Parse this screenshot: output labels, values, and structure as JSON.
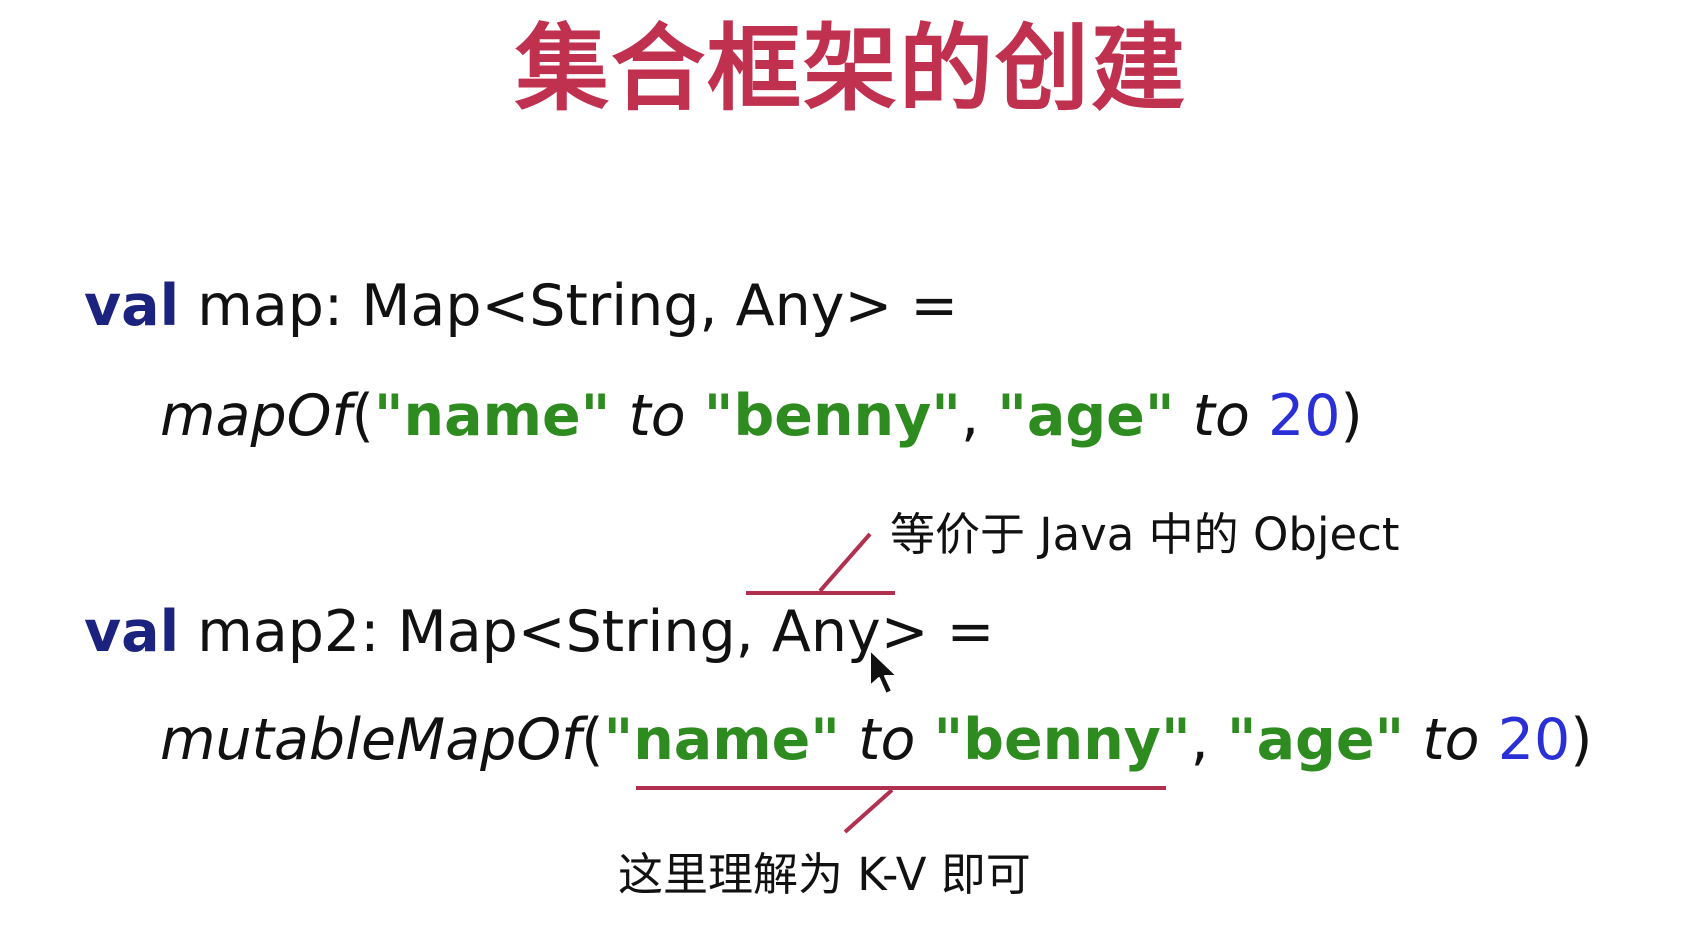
{
  "title": "集合框架的创建",
  "colors": {
    "title": "#c0304f",
    "keyword": "#1c237e",
    "string": "#2e8b1f",
    "number": "#2a2fd6",
    "annotation_line": "#b03050",
    "text": "#111111"
  },
  "code": {
    "line1": {
      "keyword": "val",
      "text": " map: Map<String, Any> ="
    },
    "line2": {
      "function": "mapOf",
      "open_paren": "(",
      "key1": "\"name\"",
      "infix1": " to ",
      "value1": "\"benny\"",
      "comma": ", ",
      "key2": "\"age\"",
      "infix2": " to ",
      "value2": "20",
      "close_paren": ")"
    },
    "line3": {
      "keyword": "val",
      "text": " map2: Map<String, Any> ="
    },
    "line4": {
      "function": "mutableMapOf",
      "open_paren": "(",
      "key1": "\"name\"",
      "infix1": " to ",
      "value1": "\"benny\"",
      "comma": ", ",
      "key2": "\"age\"",
      "infix2": " to ",
      "value2": "20",
      "close_paren": ")"
    }
  },
  "annotations": {
    "any_note": "等价于 Java 中的 Object",
    "kv_note": "这里理解为 K-V 即可"
  },
  "cursor": {
    "icon": "mouse-pointer-icon"
  }
}
